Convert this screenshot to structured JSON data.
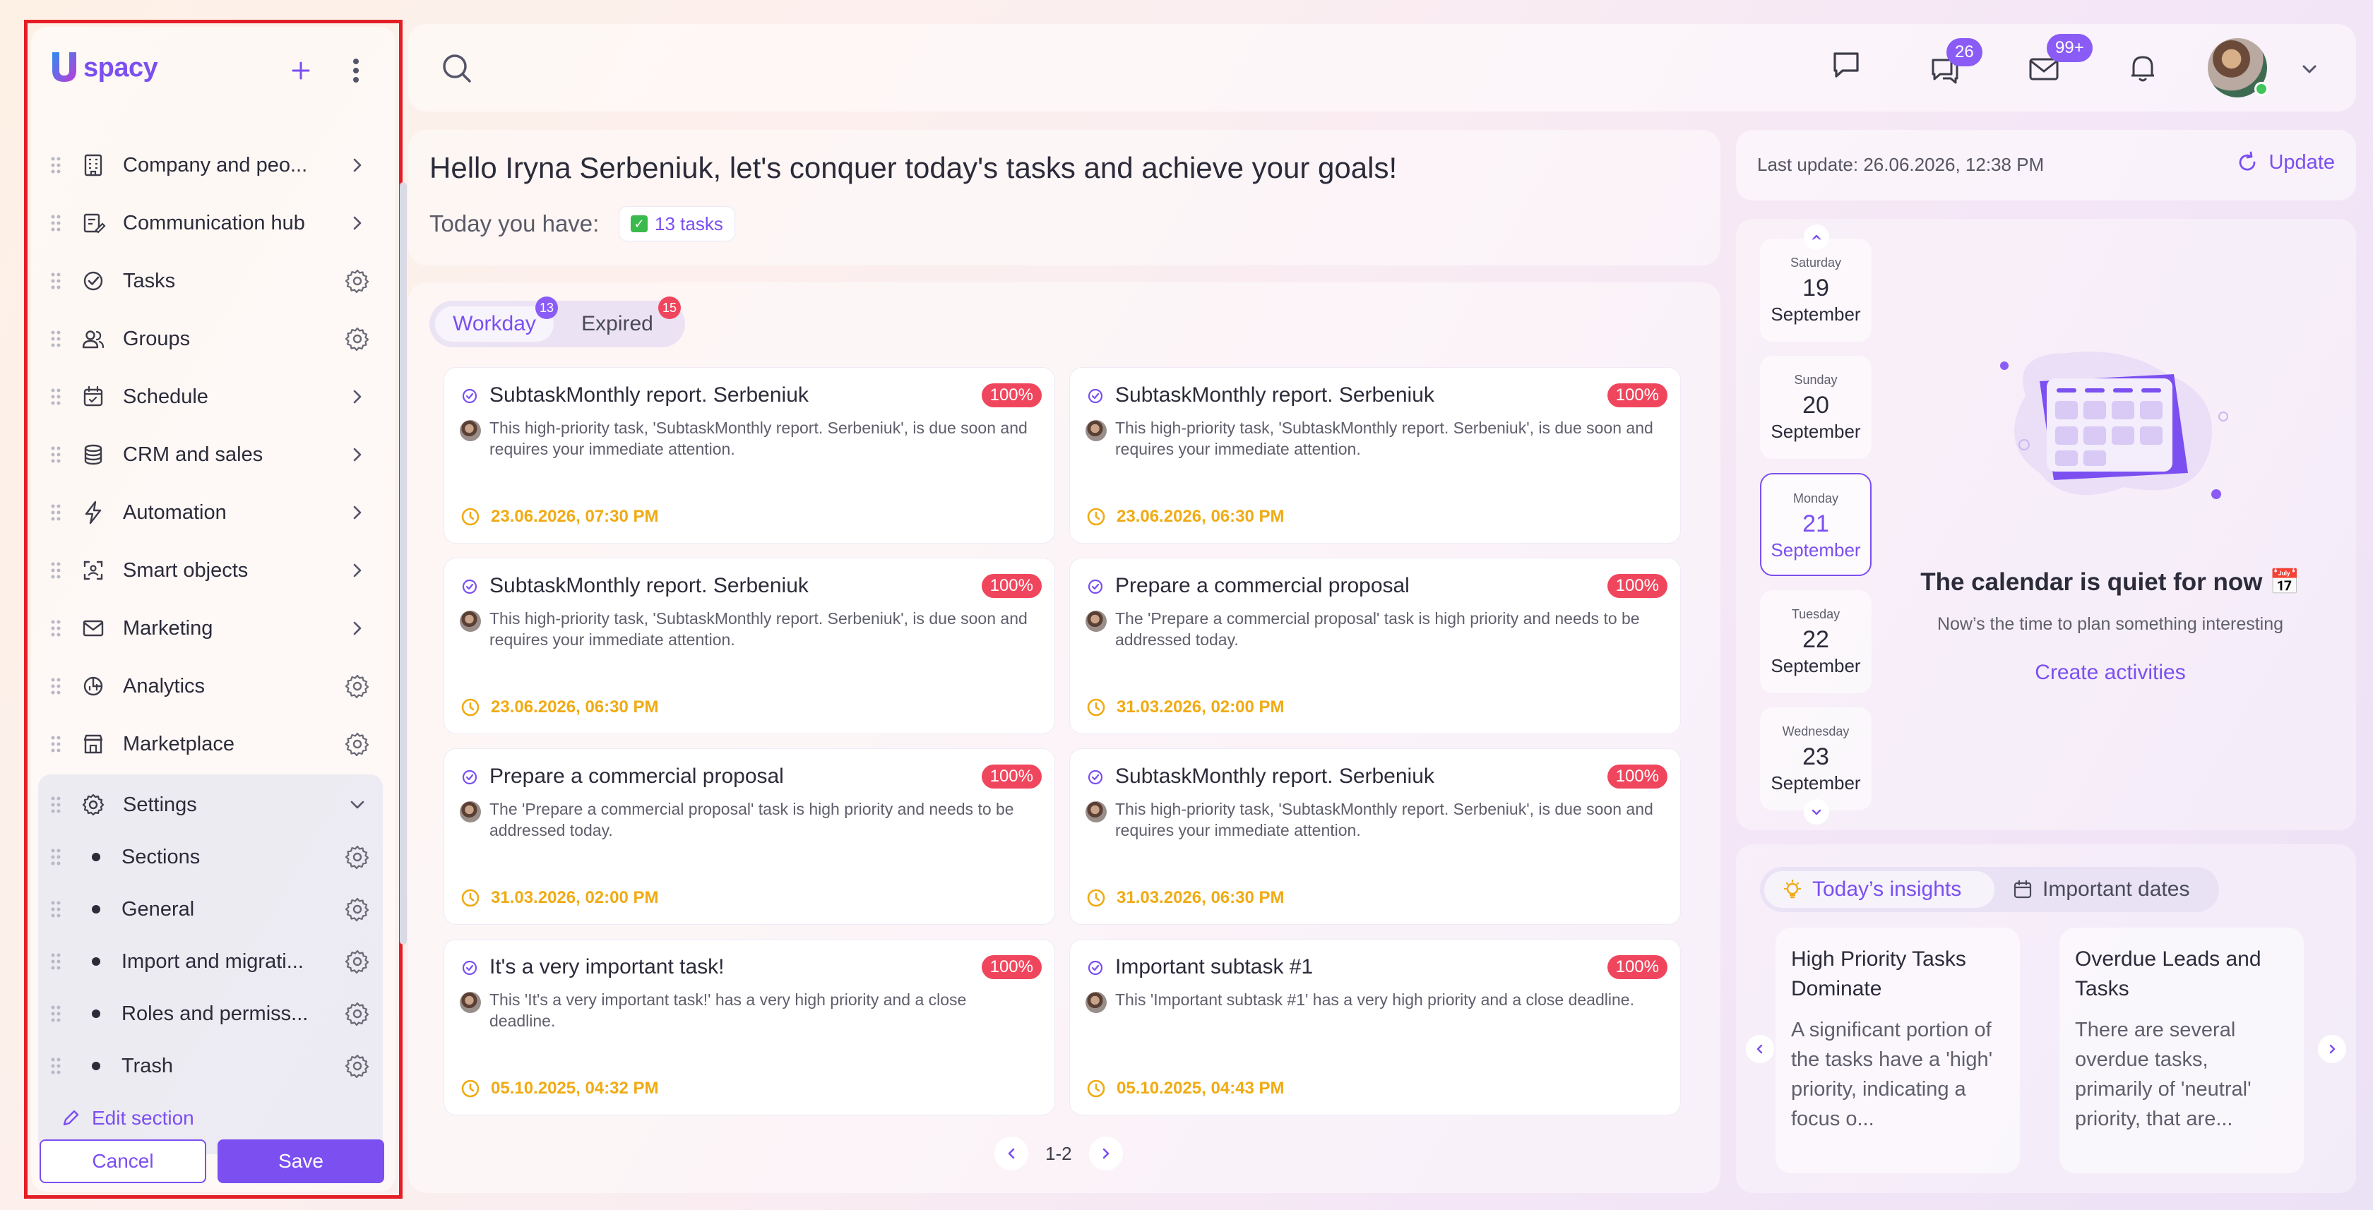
{
  "brand": {
    "logo_text": "spacy",
    "logo_letter": "U"
  },
  "sidebar": {
    "items": [
      {
        "label": "Company and peo...",
        "icon": "building-icon",
        "action": "chevron"
      },
      {
        "label": "Communication hub",
        "icon": "edit-doc-icon",
        "action": "chevron"
      },
      {
        "label": "Tasks",
        "icon": "check-circle-icon",
        "action": "gear"
      },
      {
        "label": "Groups",
        "icon": "users-icon",
        "action": "gear"
      },
      {
        "label": "Schedule",
        "icon": "calendar-icon",
        "action": "chevron"
      },
      {
        "label": "CRM and sales",
        "icon": "database-icon",
        "action": "chevron"
      },
      {
        "label": "Automation",
        "icon": "lightning-icon",
        "action": "chevron"
      },
      {
        "label": "Smart objects",
        "icon": "scan-icon",
        "action": "chevron"
      },
      {
        "label": "Marketing",
        "icon": "mail-icon",
        "action": "chevron"
      },
      {
        "label": "Analytics",
        "icon": "pie-chart-icon",
        "action": "gear"
      },
      {
        "label": "Marketplace",
        "icon": "store-icon",
        "action": "gear"
      }
    ],
    "settings": {
      "label": "Settings",
      "children": [
        {
          "label": "Sections"
        },
        {
          "label": "General"
        },
        {
          "label": "Import and migrati..."
        },
        {
          "label": "Roles and permiss..."
        },
        {
          "label": "Trash"
        }
      ]
    },
    "edit_section": "Edit section",
    "cancel": "Cancel",
    "save": "Save"
  },
  "topbar": {
    "messages_badge": "26",
    "mail_badge": "99+"
  },
  "greeting": {
    "title": "Hello Iryna Serbeniuk, let's conquer today's tasks and achieve your goals!",
    "today_label": "Today you have:",
    "tasks_count": "13 tasks"
  },
  "tasks": {
    "tabs": [
      {
        "label": "Workday",
        "badge": "13"
      },
      {
        "label": "Expired",
        "badge": "15"
      }
    ],
    "cards": [
      {
        "title": "SubtaskMonthly report. Serbeniuk",
        "pct": "100%",
        "desc": "This high-priority task, 'SubtaskMonthly report. Serbeniuk', is due soon and requires your immediate attention.",
        "due": "23.06.2026, 07:30 PM"
      },
      {
        "title": "SubtaskMonthly report. Serbeniuk",
        "pct": "100%",
        "desc": "This high-priority task, 'SubtaskMonthly report. Serbeniuk', is due soon and requires your immediate attention.",
        "due": "23.06.2026, 06:30 PM"
      },
      {
        "title": "SubtaskMonthly report. Serbeniuk",
        "pct": "100%",
        "desc": "This high-priority task, 'SubtaskMonthly report. Serbeniuk', is due soon and requires your immediate attention.",
        "due": "23.06.2026, 06:30 PM"
      },
      {
        "title": "Prepare a commercial proposal",
        "pct": "100%",
        "desc": "The 'Prepare a commercial proposal' task is high priority and needs to be addressed today.",
        "due": "31.03.2026, 02:00 PM"
      },
      {
        "title": "Prepare a commercial proposal",
        "pct": "100%",
        "desc": "The 'Prepare a commercial proposal' task is high priority and needs to be addressed today.",
        "due": "31.03.2026, 02:00 PM"
      },
      {
        "title": "SubtaskMonthly report. Serbeniuk",
        "pct": "100%",
        "desc": "This high-priority task, 'SubtaskMonthly report. Serbeniuk', is due soon and requires your immediate attention.",
        "due": "31.03.2026, 06:30 PM"
      },
      {
        "title": "It's a very important task!",
        "pct": "100%",
        "desc": "This 'It's a very important task!' has a very high priority and a close deadline.",
        "due": "05.10.2025, 04:32 PM"
      },
      {
        "title": "Important subtask #1",
        "pct": "100%",
        "desc": "This 'Important subtask #1' has a very high priority and a close deadline.",
        "due": "05.10.2025, 04:43 PM"
      }
    ],
    "pager": "1-2"
  },
  "update": {
    "last_update": "Last update: 26.06.2026, 12:38 PM",
    "button": "Update"
  },
  "calendar": {
    "days": [
      {
        "name": "Saturday",
        "date": "19",
        "month": "September",
        "selected": false
      },
      {
        "name": "Sunday",
        "date": "20",
        "month": "September",
        "selected": false
      },
      {
        "name": "Monday",
        "date": "21",
        "month": "September",
        "selected": true
      },
      {
        "name": "Tuesday",
        "date": "22",
        "month": "September",
        "selected": false
      },
      {
        "name": "Wednesday",
        "date": "23",
        "month": "September",
        "selected": false
      }
    ],
    "quiet_title": "The calendar is quiet for now 📅",
    "quiet_sub": "Now’s the time to plan something interesting",
    "create": "Create activities"
  },
  "insights": {
    "tabs": [
      "Today’s insights",
      "Important dates"
    ],
    "cards": [
      {
        "title": "High Priority Tasks Dominate",
        "text": "A significant portion of the tasks have a 'high' priority, indicating a focus o..."
      },
      {
        "title": "Overdue Leads and Tasks",
        "text": "There are several overdue tasks, primarily of 'neutral' priority, that are..."
      }
    ]
  },
  "colors": {
    "accent": "#7b4ff0",
    "danger": "#f0465d",
    "due": "#f0ab14",
    "highlight_border": "#e41e26"
  }
}
